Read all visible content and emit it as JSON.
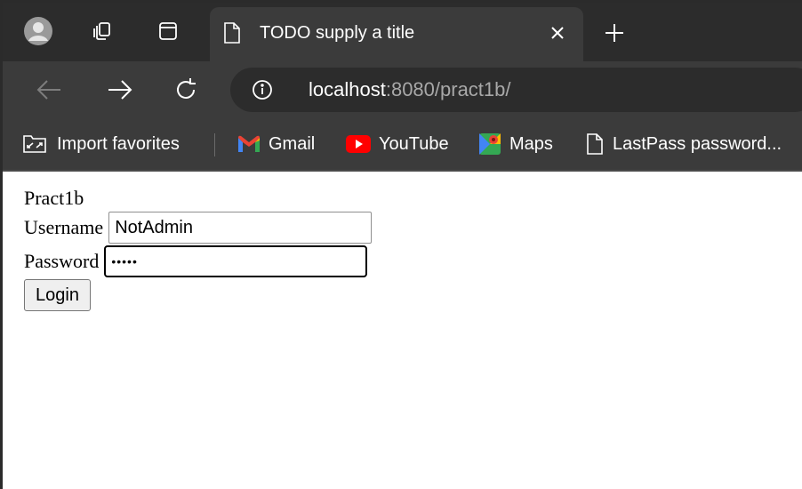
{
  "browser": {
    "tab": {
      "title": "TODO supply a title"
    },
    "address_bar": {
      "host": "localhost",
      "rest": ":8080/pract1b/"
    },
    "bookmarks": [
      {
        "label": "Import favorites",
        "icon": "import-favorites-icon"
      },
      {
        "label": "Gmail",
        "icon": "gmail-icon"
      },
      {
        "label": "YouTube",
        "icon": "youtube-icon"
      },
      {
        "label": "Maps",
        "icon": "maps-icon"
      },
      {
        "label": "LastPass password...",
        "icon": "page-icon"
      }
    ]
  },
  "page": {
    "heading": "Pract1b",
    "form": {
      "username_label": "Username",
      "username_value": "NotAdmin",
      "password_label": "Password",
      "password_value": "•••••",
      "login_label": "Login"
    }
  },
  "colors": {
    "tabstrip": "#2c2c2c",
    "toolbar": "#3b3b3b",
    "gmail_red": "#ea4335",
    "youtube_red": "#ff0000"
  }
}
